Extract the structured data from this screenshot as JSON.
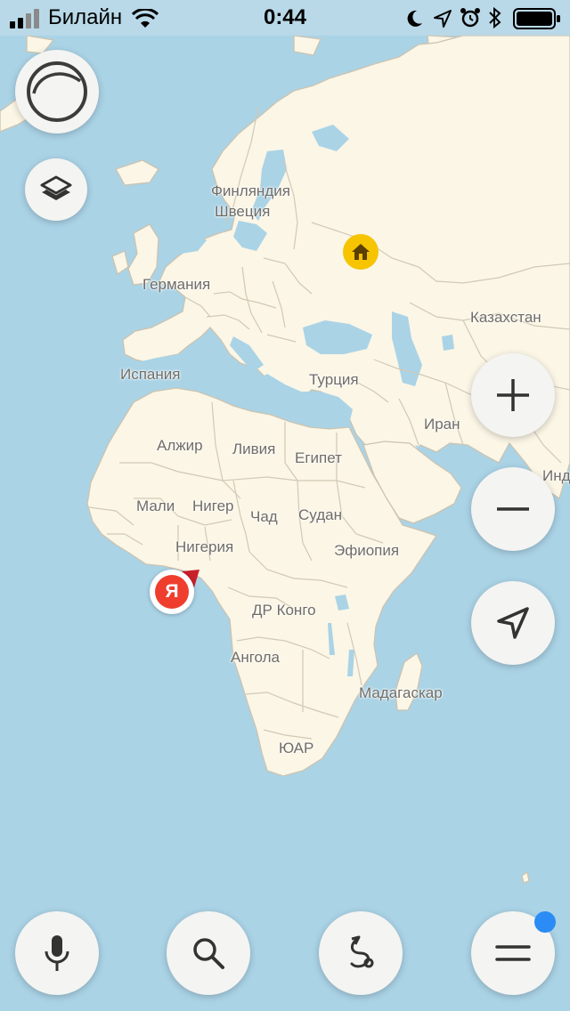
{
  "status_bar": {
    "carrier": "Билайн",
    "time": "0:44",
    "icons": [
      "signal-bars-icon",
      "wifi-icon",
      "moon-icon",
      "location-arrow-icon",
      "alarm-icon",
      "bluetooth-icon",
      "battery-icon"
    ]
  },
  "map": {
    "labels": {
      "finland": "Финляндия",
      "sweden": "Швеция",
      "germany": "Германия",
      "kazakhstan": "Казахстан",
      "spain": "Испания",
      "turkey": "Турция",
      "iran": "Иран",
      "india": "Инд",
      "algeria": "Алжир",
      "libya": "Ливия",
      "egypt": "Египет",
      "mali": "Мали",
      "niger": "Нигер",
      "chad": "Чад",
      "sudan": "Судан",
      "nigeria": "Нигерия",
      "ethiopia": "Эфиопия",
      "dr_congo": "ДР Конго",
      "angola": "Ангола",
      "madagascar": "Мадагаскар",
      "south_africa": "ЮАР"
    },
    "user_marker": "Я",
    "home_marker_icon": "home-icon"
  },
  "controls": {
    "top_left": [
      "alice-assistant-icon",
      "layers-icon"
    ],
    "right": [
      "zoom-in-icon",
      "zoom-out-icon",
      "my-location-icon"
    ],
    "bottom": [
      "microphone-icon",
      "search-icon",
      "routes-icon",
      "menu-icon"
    ],
    "menu_has_notification": true
  },
  "colors": {
    "water": "#aad3e6",
    "land": "#fbf6e6",
    "home_marker": "#f6c400",
    "user_marker": "#ef3e2e",
    "notification_dot": "#2a8cf4"
  }
}
